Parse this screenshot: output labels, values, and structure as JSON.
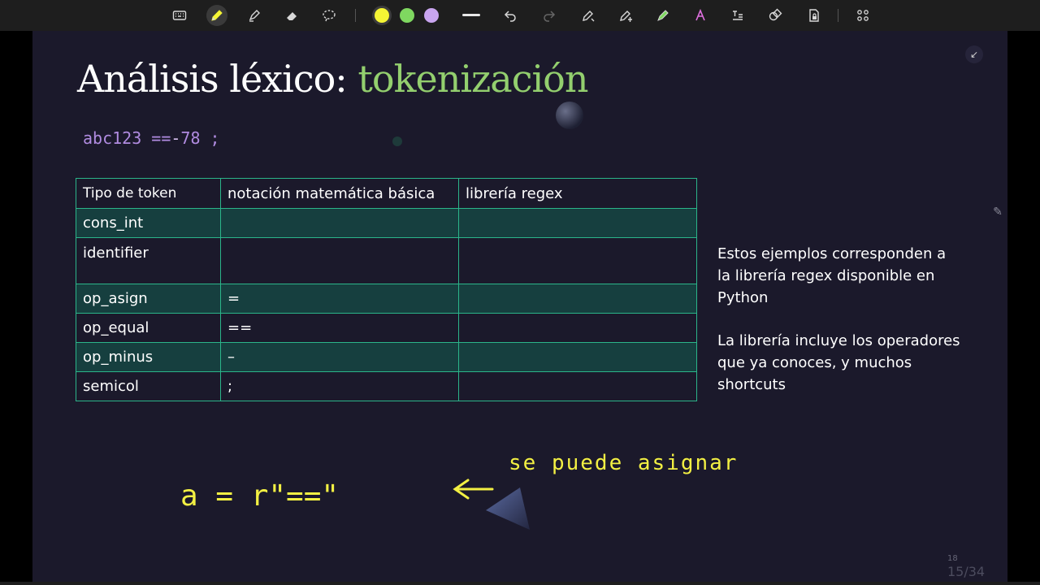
{
  "slide": {
    "title_main": "Análisis léxico: ",
    "title_accent": "tokenización",
    "code": {
      "part1": "abc123 ==",
      "part2": "-",
      "part3": "78 ;"
    },
    "table": {
      "headers": [
        "Tipo de token",
        "notación matemática básica",
        "librería regex"
      ],
      "rows": [
        [
          "cons_int",
          "",
          ""
        ],
        [
          "identifier",
          "",
          ""
        ],
        [
          "op_asign",
          "=",
          ""
        ],
        [
          "op_equal",
          "==",
          ""
        ],
        [
          "op_minus",
          "–",
          ""
        ],
        [
          "semicol",
          ";",
          ""
        ]
      ]
    },
    "note1": "Estos ejemplos corresponden a la librería regex disponible en Python",
    "note2": "La librería incluye los operadores que ya conoces, y muchos shortcuts",
    "annotation": {
      "expression": "a = r\"==\"",
      "comment": "se puede asignar"
    },
    "page_number": "18",
    "page_counter": "15/34"
  },
  "colors": {
    "slide_bg": "#1b192b",
    "title_accent": "#93cf6e",
    "code": "#b08be0",
    "table_border": "#2bb58a",
    "table_cell": "#163f3f",
    "ink_yellow": "#f3f043",
    "pen_yellow": "#f5f534",
    "pen_green": "#7fd860",
    "pen_purple": "#c9a5ef"
  },
  "toolbar": {
    "tools": [
      "keyboard-icon",
      "pen-icon",
      "highlighter-icon",
      "eraser-icon",
      "lasso-icon",
      "yellow-pen",
      "green-pen",
      "purple-pen",
      "pen-width",
      "undo-icon",
      "redo-icon",
      "shape-icon",
      "text-icon",
      "marker-icon",
      "handwriting-icon",
      "text-recognition-icon",
      "shapes-icon",
      "lock-icon",
      "grid-icon"
    ]
  }
}
